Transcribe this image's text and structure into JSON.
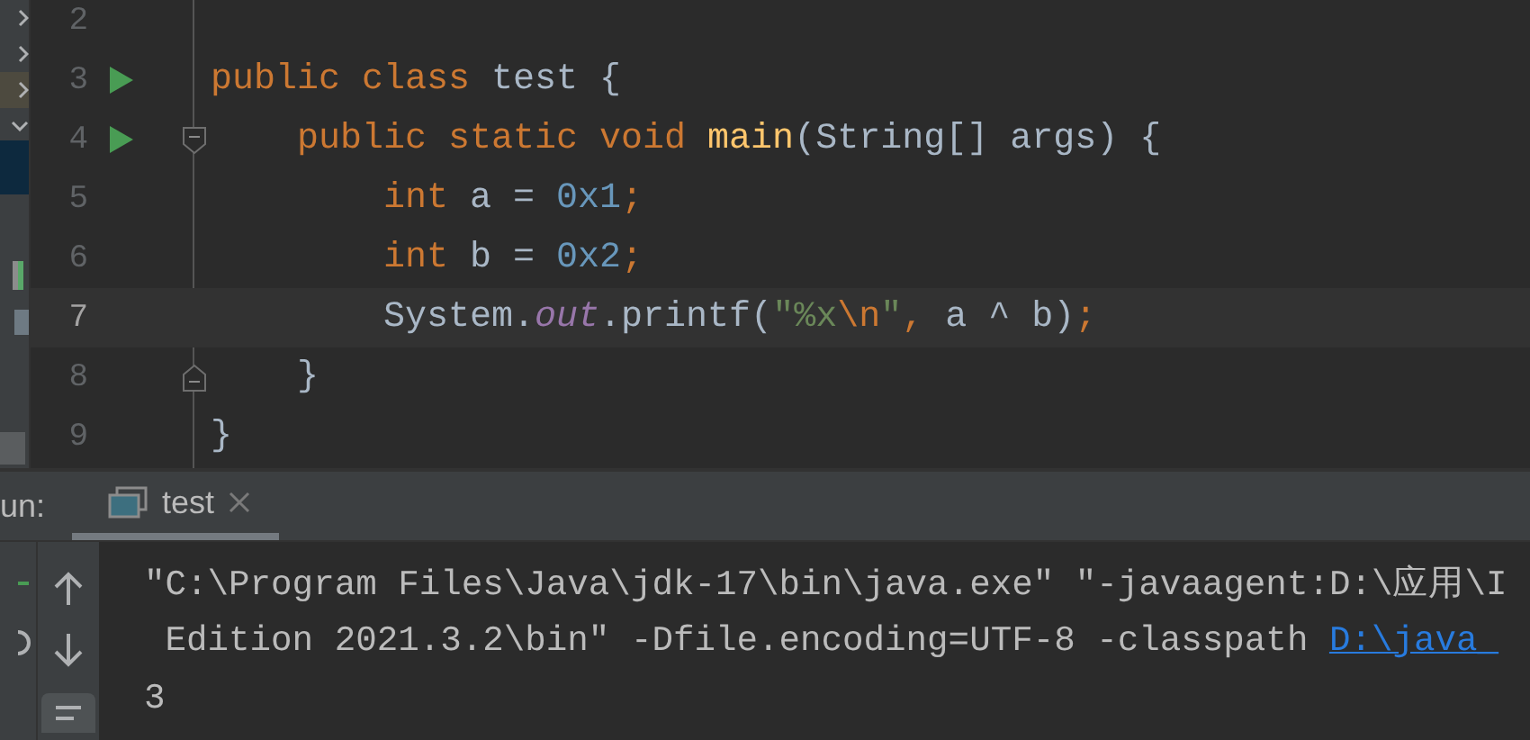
{
  "editor": {
    "lines": [
      {
        "number": "2",
        "current": false,
        "run": false,
        "fold_start": false,
        "fold_end": false
      },
      {
        "number": "3",
        "current": false,
        "run": true,
        "fold_start": false,
        "fold_end": false,
        "tokens": [
          {
            "text": "public class ",
            "kind": "keyword"
          },
          {
            "text": "test {",
            "kind": "plain"
          }
        ]
      },
      {
        "number": "4",
        "current": false,
        "run": true,
        "fold_start": true,
        "fold_end": false,
        "tokens": [
          {
            "text": "    public static void ",
            "kind": "keyword"
          },
          {
            "text": "main",
            "kind": "method"
          },
          {
            "text": "(String[] args) {",
            "kind": "plain"
          }
        ]
      },
      {
        "number": "5",
        "current": false,
        "run": false,
        "fold_start": false,
        "fold_end": false,
        "tokens": [
          {
            "text": "        int ",
            "kind": "keyword"
          },
          {
            "text": "a = ",
            "kind": "plain"
          },
          {
            "text": "0x1",
            "kind": "number"
          },
          {
            "text": ";",
            "kind": "punct"
          }
        ]
      },
      {
        "number": "6",
        "current": false,
        "run": false,
        "fold_start": false,
        "fold_end": false,
        "tokens": [
          {
            "text": "        int ",
            "kind": "keyword"
          },
          {
            "text": "b = ",
            "kind": "plain"
          },
          {
            "text": "0x2",
            "kind": "number"
          },
          {
            "text": ";",
            "kind": "punct"
          }
        ]
      },
      {
        "number": "7",
        "current": true,
        "run": false,
        "fold_start": false,
        "fold_end": false,
        "tokens": [
          {
            "text": "        System.",
            "kind": "plain"
          },
          {
            "text": "out",
            "kind": "field"
          },
          {
            "text": ".printf(",
            "kind": "plain"
          },
          {
            "text": "\"%x",
            "kind": "string"
          },
          {
            "text": "\\n",
            "kind": "escape"
          },
          {
            "text": "\"",
            "kind": "string"
          },
          {
            "text": ", ",
            "kind": "punct"
          },
          {
            "text": "a ^ b)",
            "kind": "plain"
          },
          {
            "text": ";",
            "kind": "punct"
          }
        ]
      },
      {
        "number": "8",
        "current": false,
        "run": false,
        "fold_start": false,
        "fold_end": true,
        "tokens": [
          {
            "text": "    }",
            "kind": "plain"
          }
        ]
      },
      {
        "number": "9",
        "current": false,
        "run": false,
        "fold_start": false,
        "fold_end": false,
        "tokens": [
          {
            "text": "}",
            "kind": "plain"
          }
        ]
      }
    ]
  },
  "run_panel": {
    "label": "un:",
    "tabs": [
      {
        "label": "test",
        "selected": true,
        "closable": true
      }
    ]
  },
  "console": {
    "lines": [
      [
        {
          "text": "\"C:\\Program Files\\Java\\jdk-17\\bin\\java.exe\" \"-javaagent:D:\\应用\\I",
          "kind": "text"
        }
      ],
      [
        {
          "text": " Edition 2021.3.2\\bin\" -Dfile.encoding=UTF-8 -classpath ",
          "kind": "text"
        },
        {
          "text": "D:\\java_",
          "kind": "link"
        }
      ],
      [
        {
          "text": "3",
          "kind": "text"
        }
      ]
    ]
  }
}
